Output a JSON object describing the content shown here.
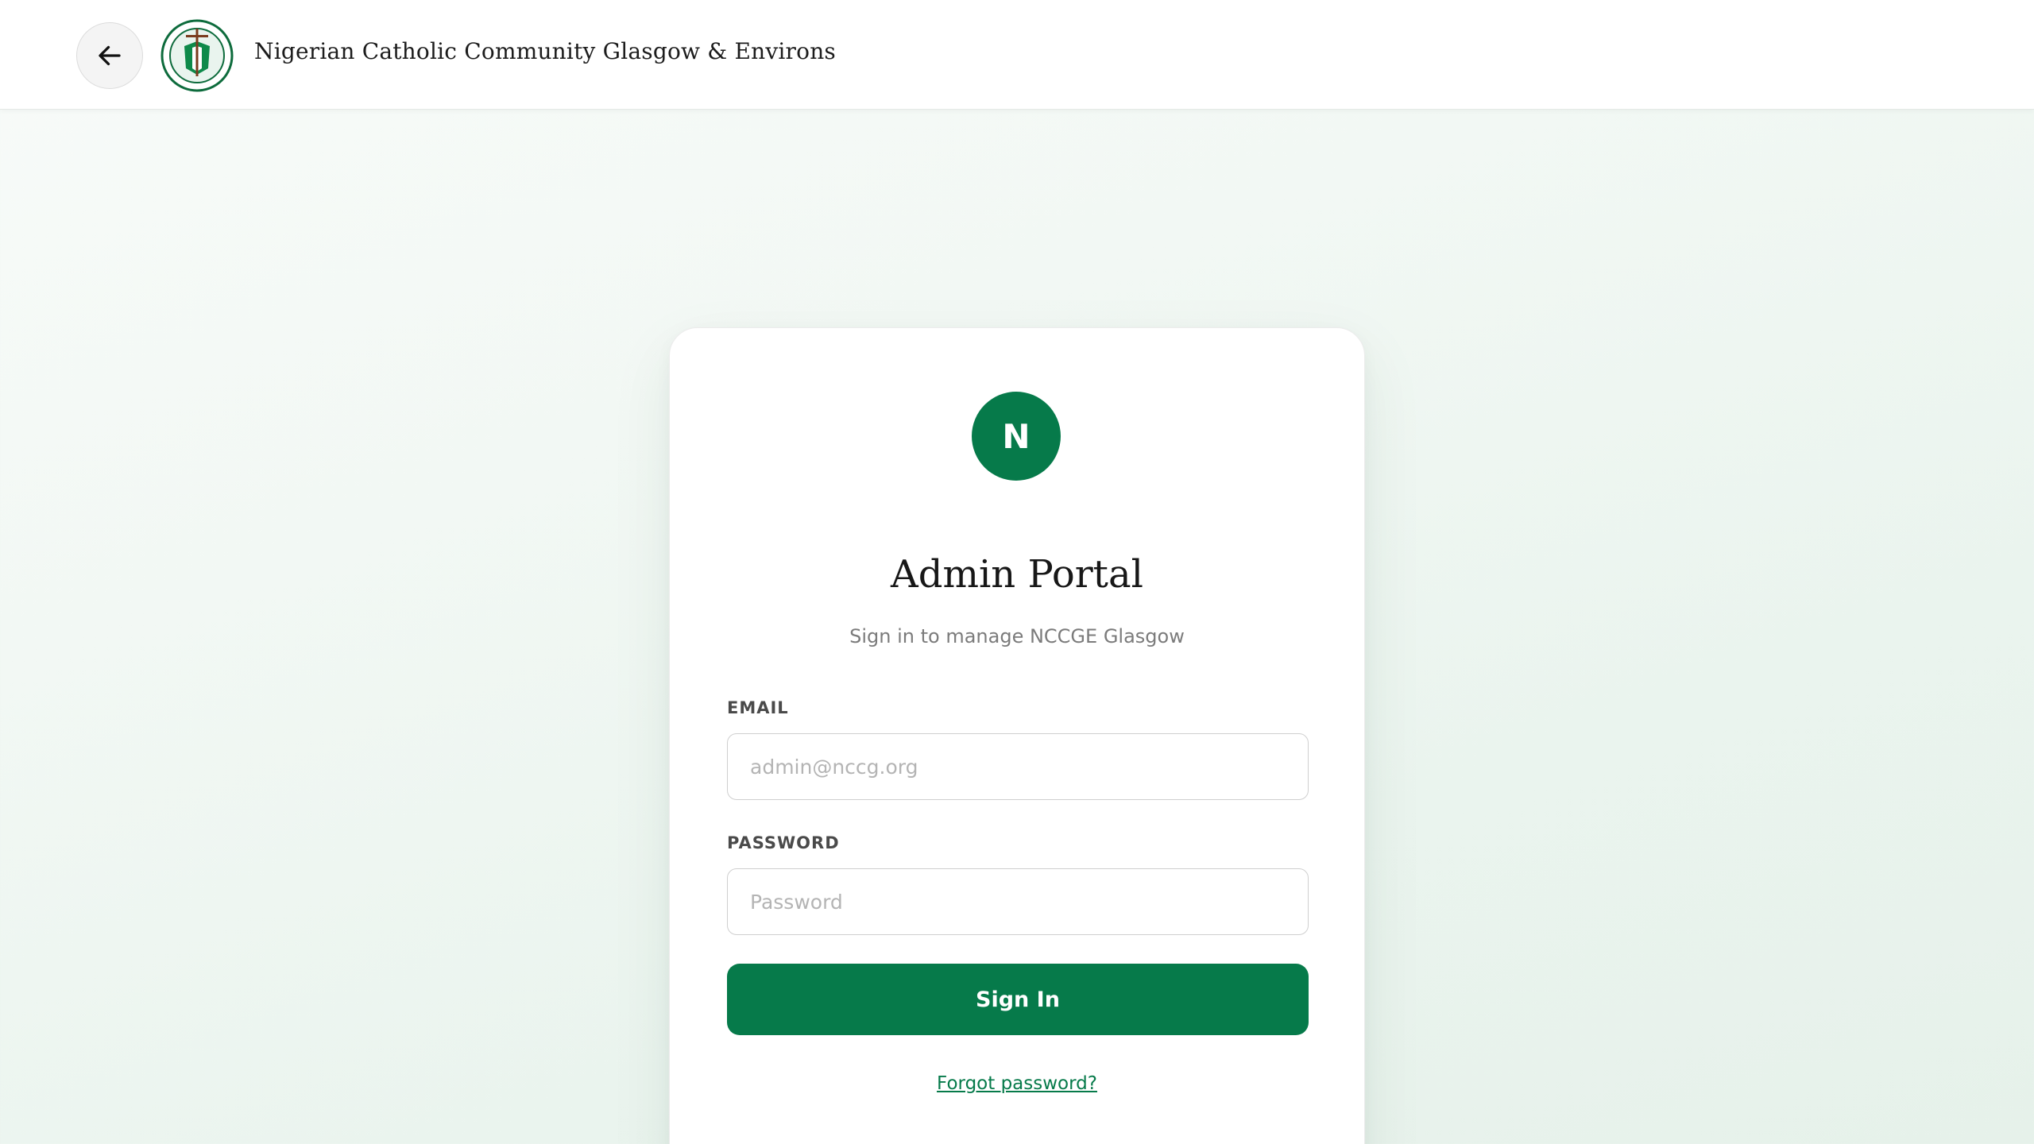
{
  "header": {
    "back_icon": "arrow-left-icon",
    "logo_icon": "community-emblem-icon",
    "site_title": "Nigerian Catholic Community Glasgow & Environs"
  },
  "card": {
    "avatar_letter": "N",
    "title": "Admin Portal",
    "subtitle": "Sign in to manage NCCGE Glasgow",
    "email": {
      "label": "EMAIL",
      "placeholder": "admin@nccg.org",
      "value": ""
    },
    "password": {
      "label": "PASSWORD",
      "placeholder": "Password",
      "value": ""
    },
    "signin_label": "Sign In",
    "forgot_label": "Forgot password?"
  },
  "colors": {
    "brand_green": "#067a4a",
    "background": "#f2f8f4"
  }
}
